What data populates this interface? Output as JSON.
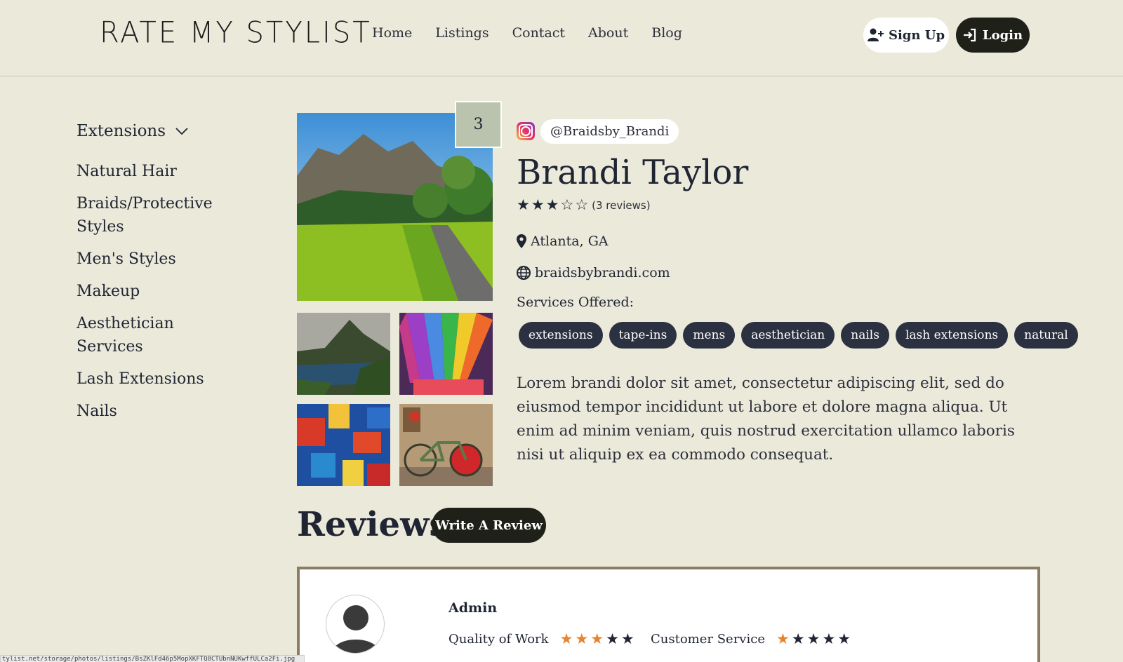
{
  "header": {
    "logo": "RATE MY STYLIST",
    "nav": [
      "Home",
      "Listings",
      "Contact",
      "About",
      "Blog"
    ],
    "signup_label": "Sign Up",
    "login_label": "Login"
  },
  "sidebar": {
    "dropdown_label": "Extensions",
    "items": [
      "Natural Hair",
      "Braids/Protective Styles",
      "Men's Styles",
      "Makeup",
      "Aesthetician Services",
      "Lash Extensions",
      "Nails"
    ]
  },
  "gallery": {
    "photo_count": "3"
  },
  "profile": {
    "instagram_handle": "@Braidsby_Brandi",
    "name": "Brandi Taylor",
    "rating": 3,
    "rating_max": 5,
    "review_count_text": "(3 reviews)",
    "location": "Atlanta, GA",
    "website": "braidsbybrandi.com",
    "services_label": "Services Offered:",
    "services": [
      "extensions",
      "tape-ins",
      "mens",
      "aesthetician",
      "nails",
      "lash extensions",
      "natural"
    ],
    "bio": "Lorem brandi dolor sit amet, consectetur adipiscing elit, sed do eiusmod tempor incididunt ut labore et dolore magna aliqua. Ut enim ad minim veniam, quis nostrud exercitation ullamco laboris nisi ut aliquip ex ea commodo consequat."
  },
  "reviews": {
    "title": "Reviews",
    "write_label": "Write A Review",
    "items": [
      {
        "author": "Admin",
        "criteria": [
          {
            "label": "Quality of Work",
            "rating": 3
          },
          {
            "label": "Customer Service",
            "rating": 1
          }
        ]
      }
    ]
  },
  "status_bar": "tylist.net/storage/photos/listings/BsZKlFd46p5MopXKFTQ8CTUbnNUKwffULCa2Fi.jpg",
  "colors": {
    "background": "#ebe9da",
    "dark": "#1f2119",
    "tag": "#2b3140",
    "star_orange": "#e6832d",
    "badge": "#b9c3ad"
  }
}
